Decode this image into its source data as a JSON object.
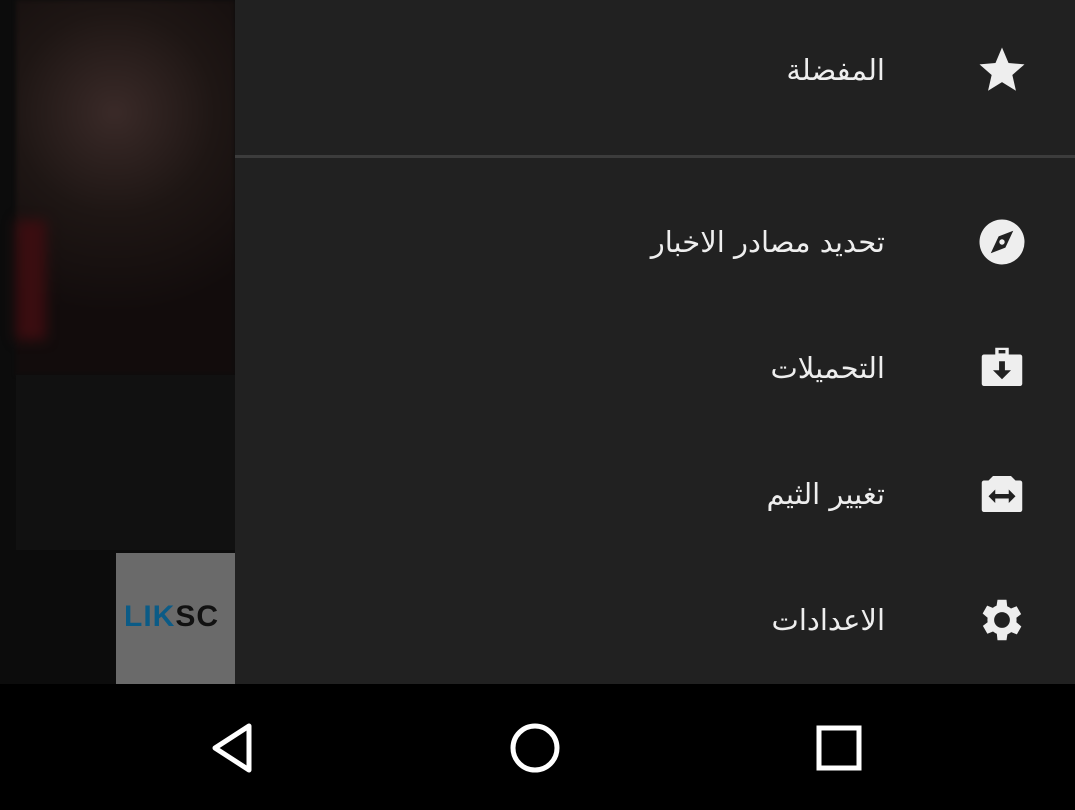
{
  "background": {
    "logo_text_a": "LIK",
    "logo_text_b": "SC"
  },
  "drawer": {
    "items": [
      {
        "label": "المفضلة",
        "icon": "star-icon"
      },
      {
        "label": "تحديد مصادر الاخبار",
        "icon": "compass-icon"
      },
      {
        "label": "التحميلات",
        "icon": "briefcase-download-icon"
      },
      {
        "label": "تغيير الثيم",
        "icon": "camera-switch-icon"
      },
      {
        "label": "الاعدادات",
        "icon": "gear-icon"
      }
    ]
  },
  "nav": {
    "back": "back-icon",
    "home": "home-icon",
    "recents": "recents-icon"
  },
  "colors": {
    "drawer": "#212121",
    "text": "#eeeeee",
    "nav": "#000000"
  }
}
